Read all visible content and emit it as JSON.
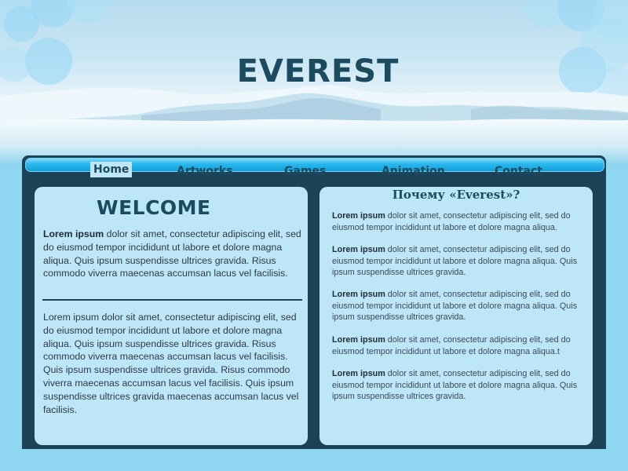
{
  "site": {
    "title": "EVEREST"
  },
  "nav": {
    "items": [
      {
        "label": "Home"
      },
      {
        "label": "Artworks"
      },
      {
        "label": "Games"
      },
      {
        "label": "Animation"
      },
      {
        "label": "Contact"
      }
    ],
    "active": "Home"
  },
  "welcome": {
    "title": "WELCOME",
    "intro_bold": "Lorem ipsum",
    "intro_rest": " dolor sit amet, consectetur adipiscing elit, sed do eiusmod tempor incididunt ut labore et dolore magna aliqua. Quis ipsum suspendisse ultrices gravida. Risus commodo viverra maecenas accumsan lacus vel facilisis.",
    "body": "Lorem ipsum dolor sit amet, consectetur adipiscing elit, sed do eiusmod tempor incididunt ut labore et dolore magna aliqua. Quis ipsum suspendisse ultrices gravida. Risus commodo viverra maecenas accumsan lacus vel facilisis.  Quis ipsum suspendisse ultrices gravida. Risus commodo viverra maecenas accumsan lacus vel facilisis. Quis ipsum suspendisse ultrices gravida maecenas accumsan lacus vel facilisis."
  },
  "why": {
    "title": "Почему «Everest»?",
    "paragraphs": [
      {
        "bold": "Lorem ipsum",
        "text": " dolor sit amet, consectetur adipiscing elit, sed do eiusmod tempor incididunt ut labore et dolore magna aliqua."
      },
      {
        "bold": "Lorem ipsum",
        "text": " dolor sit amet, consectetur adipiscing elit, sed do eiusmod tempor incididunt ut labore et dolore magna aliqua. Quis ipsum suspendisse ultrices gravida."
      },
      {
        "bold": "Lorem ipsum",
        "text": " dolor sit amet, consectetur adipiscing elit, sed do eiusmod tempor incididunt ut labore et dolore magna aliqua. Quis ipsum suspendisse ultrices gravida."
      },
      {
        "bold": "Lorem ipsum",
        "text": " dolor sit amet, consectetur adipiscing elit, sed do eiusmod tempor incididunt ut labore et dolore magna aliqua.t"
      },
      {
        "bold": "Lorem ipsum",
        "text": " dolor sit amet, consectetur adipiscing elit, sed do eiusmod tempor incididunt ut labore et dolore magna aliqua. Quis ipsum suspendisse ultrices gravida."
      }
    ]
  },
  "colors": {
    "dark_navy": "#1b4256",
    "panel": "#bde6f8",
    "page_bg": "#8fd6f0",
    "nav_bar": "#28b7ec"
  }
}
